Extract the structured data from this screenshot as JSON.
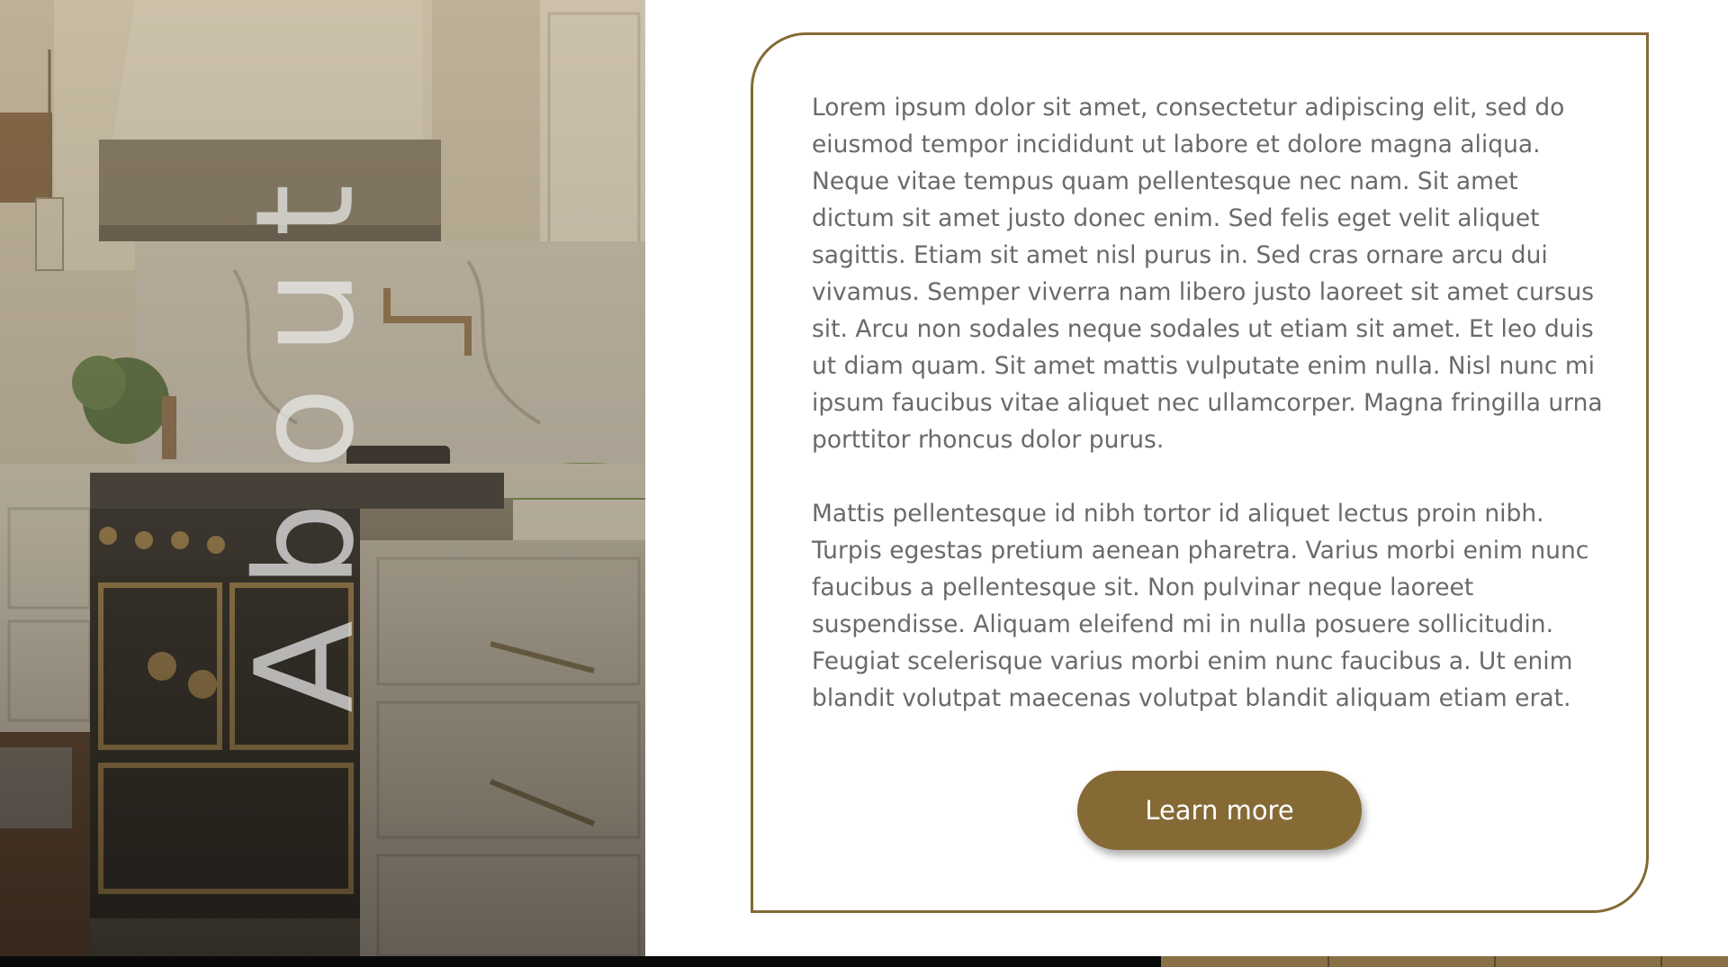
{
  "section": {
    "title": "About"
  },
  "card": {
    "paragraphs": [
      "Lorem ipsum dolor sit amet, consectetur adipiscing elit, sed do eiusmod tempor incididunt ut labore et dolore magna aliqua. Neque vitae tempus quam pellentesque nec nam. Sit amet dictum sit amet justo donec enim. Sed felis eget velit aliquet sagittis. Etiam sit amet nisl purus in. Sed cras ornare arcu dui vivamus. Semper viverra nam libero justo laoreet sit amet cursus sit. Arcu non sodales neque sodales ut etiam sit amet. Et leo duis ut diam quam. Sit amet mattis vulputate enim nulla. Nisl nunc mi ipsum faucibus vitae aliquet nec ullamcorper. Magna fringilla urna porttitor rhoncus dolor purus.",
      "Mattis pellentesque id nibh tortor id aliquet lectus proin nibh. Turpis egestas pretium aenean pharetra. Varius morbi enim nunc faucibus a pellentesque sit. Non pulvinar neque laoreet suspendisse. Aliquam eleifend mi in nulla posuere sollicitudin. Feugiat scelerisque varius morbi enim nunc faucibus a. Ut enim blandit volutpat maecenas volutpat blandit aliquam etiam erat."
    ],
    "button_label": "Learn more"
  },
  "colors": {
    "accent": "#856a36",
    "body_text": "#6a6a6a",
    "background": "#ffffff"
  }
}
